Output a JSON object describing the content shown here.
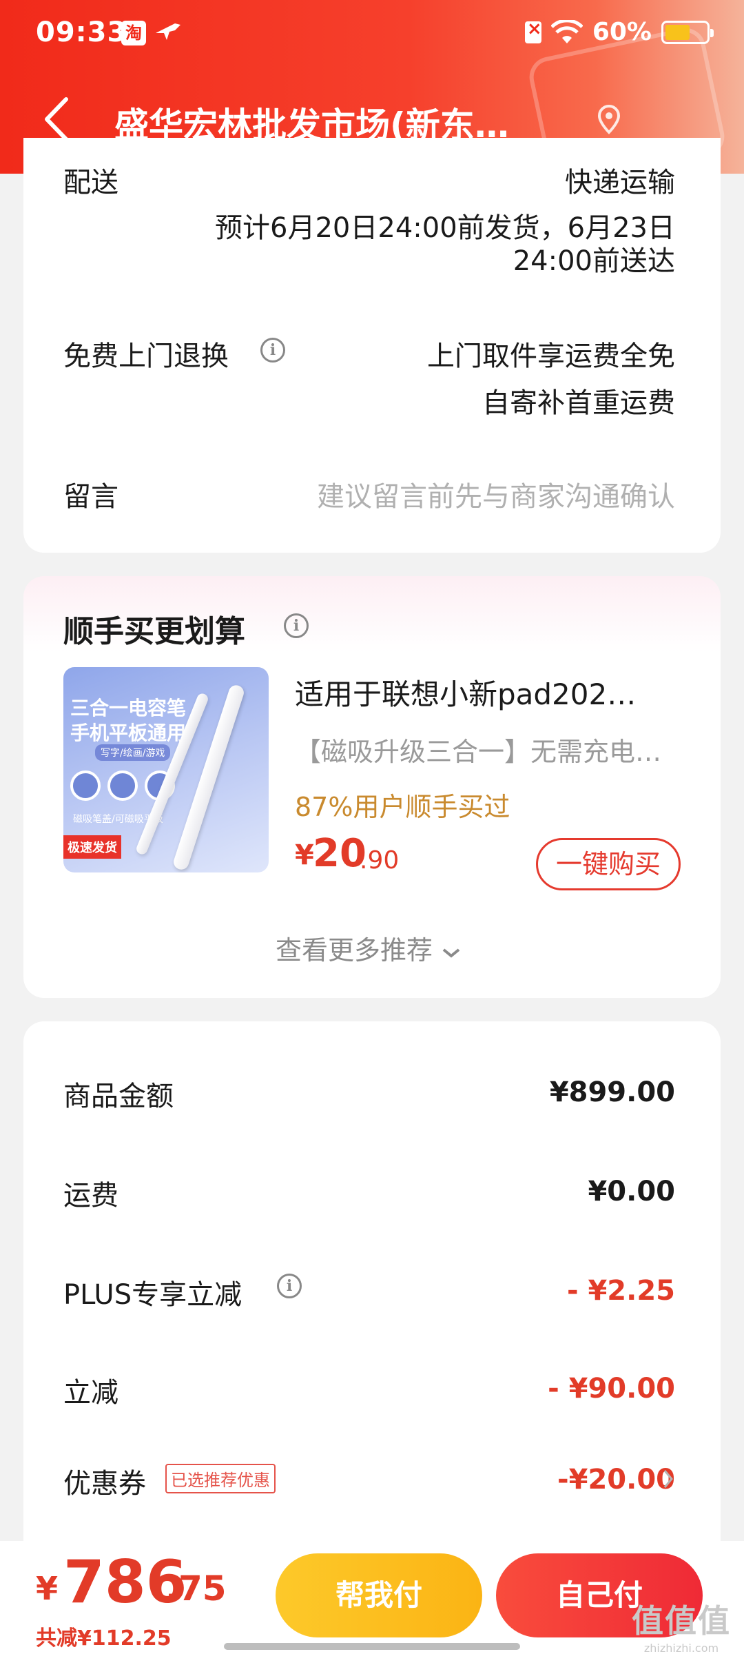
{
  "status_bar": {
    "time": "09:33",
    "app_icon_label": "淘",
    "battery_percent": "60%",
    "battery_level": 0.6,
    "battery_color": "#f8c21b"
  },
  "nav": {
    "title": "盛华宏林批发市场(新东…"
  },
  "delivery": {
    "label": "配送",
    "method": "快递运输",
    "estimate_line1": "预计6月20日24:00前发货，6月23日",
    "estimate_line2": "24:00前送达"
  },
  "return_service": {
    "label": "免费上门退换",
    "line1": "上门取件享运费全免",
    "line2": "自寄补首重运费"
  },
  "message": {
    "label": "留言",
    "placeholder": "建议留言前先与商家沟通确认"
  },
  "recommend": {
    "section_title": "顺手买更划算",
    "image_text1": "三合一电容笔",
    "image_text2": "手机平板通用",
    "image_text3": "写字/绘画/游戏",
    "image_text4": "磁吸笔盖/可磁吸平板",
    "image_badge": "极速发货",
    "product_title": "适用于联想小新pad202…",
    "product_subtitle": "【磁吸升级三合一】无需充电…",
    "social_proof": "87%用户顺手买过",
    "currency": "¥",
    "price_int": "20",
    "price_dec": ".90",
    "buy_button": "一键购买",
    "more_link": "查看更多推荐"
  },
  "summary": {
    "goods_label": "商品金额",
    "goods_value": "¥899.00",
    "shipping_label": "运费",
    "shipping_value": "¥0.00",
    "plus_label": "PLUS专享立减",
    "plus_value": "- ¥2.25",
    "discount_label": "立减",
    "discount_value": "- ¥90.00",
    "coupon_label": "优惠券",
    "coupon_tag": "已选推荐优惠",
    "coupon_value": "-¥20.00"
  },
  "bottom": {
    "currency": "¥",
    "total_int": "786",
    "total_dec": ".75",
    "saved": "共减¥112.25",
    "help_pay": "帮我付",
    "self_pay": "自己付"
  },
  "watermark": {
    "line1": "值值值",
    "line2": "zhizhizhi.com"
  }
}
